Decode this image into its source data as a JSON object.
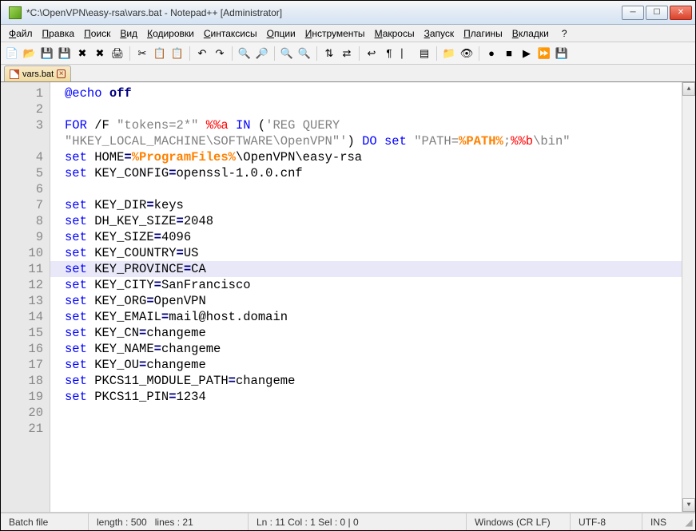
{
  "window": {
    "title": "*C:\\OpenVPN\\easy-rsa\\vars.bat - Notepad++ [Administrator]"
  },
  "menu": {
    "items": [
      "Файл",
      "Правка",
      "Поиск",
      "Вид",
      "Кодировки",
      "Синтаксисы",
      "Опции",
      "Инструменты",
      "Макросы",
      "Запуск",
      "Плагины",
      "Вкладки",
      "?"
    ]
  },
  "tab": {
    "label": "vars.bat"
  },
  "code": {
    "lines": [
      [
        {
          "t": "@echo",
          "c": "kw-blue"
        },
        {
          "t": " off",
          "c": "kw-dark"
        }
      ],
      [],
      [
        {
          "t": "FOR",
          "c": "kw-blue"
        },
        {
          "t": " /F ",
          "c": ""
        },
        {
          "t": "\"tokens=2*\"",
          "c": "str-gray"
        },
        {
          "t": " ",
          "c": ""
        },
        {
          "t": "%%a",
          "c": "kw-red"
        },
        {
          "t": " ",
          "c": ""
        },
        {
          "t": "IN",
          "c": "kw-blue"
        },
        {
          "t": " (",
          "c": ""
        },
        {
          "t": "'REG QUERY \n\"HKEY_LOCAL_MACHINE\\SOFTWARE\\OpenVPN\"'",
          "c": "str-gray"
        },
        {
          "t": ") ",
          "c": ""
        },
        {
          "t": "DO",
          "c": "kw-blue"
        },
        {
          "t": " ",
          "c": ""
        },
        {
          "t": "set",
          "c": "kw-blue"
        },
        {
          "t": " ",
          "c": ""
        },
        {
          "t": "\"PATH=",
          "c": "str-gray"
        },
        {
          "t": "%PATH%",
          "c": "var-orange"
        },
        {
          "t": ";",
          "c": "str-gray"
        },
        {
          "t": "%%b",
          "c": "kw-red"
        },
        {
          "t": "\\bin\"",
          "c": "str-gray"
        }
      ],
      [],
      [
        {
          "t": "set",
          "c": "kw-blue"
        },
        {
          "t": " HOME",
          "c": ""
        },
        {
          "t": "=",
          "c": "kw-dark"
        },
        {
          "t": "%ProgramFiles%",
          "c": "var-orange"
        },
        {
          "t": "\\OpenVPN\\easy-rsa",
          "c": ""
        }
      ],
      [
        {
          "t": "set",
          "c": "kw-blue"
        },
        {
          "t": " KEY_CONFIG",
          "c": ""
        },
        {
          "t": "=",
          "c": "kw-dark"
        },
        {
          "t": "openssl-1.0.0.cnf",
          "c": ""
        }
      ],
      [],
      [
        {
          "t": "set",
          "c": "kw-blue"
        },
        {
          "t": " KEY_DIR",
          "c": ""
        },
        {
          "t": "=",
          "c": "kw-dark"
        },
        {
          "t": "keys",
          "c": ""
        }
      ],
      [
        {
          "t": "set",
          "c": "kw-blue"
        },
        {
          "t": " DH_KEY_SIZE",
          "c": ""
        },
        {
          "t": "=",
          "c": "kw-dark"
        },
        {
          "t": "2048",
          "c": ""
        }
      ],
      [
        {
          "t": "set",
          "c": "kw-blue"
        },
        {
          "t": " KEY_SIZE",
          "c": ""
        },
        {
          "t": "=",
          "c": "kw-dark"
        },
        {
          "t": "4096",
          "c": ""
        }
      ],
      [
        {
          "t": "set",
          "c": "kw-blue"
        },
        {
          "t": " KEY_COUNTRY",
          "c": ""
        },
        {
          "t": "=",
          "c": "kw-dark"
        },
        {
          "t": "US",
          "c": ""
        }
      ],
      [
        {
          "t": "set",
          "c": "kw-blue"
        },
        {
          "t": " KEY_PROVINCE",
          "c": ""
        },
        {
          "t": "=",
          "c": "kw-dark"
        },
        {
          "t": "CA",
          "c": ""
        }
      ],
      [
        {
          "t": "set",
          "c": "kw-blue"
        },
        {
          "t": " KEY_CITY",
          "c": ""
        },
        {
          "t": "=",
          "c": "kw-dark"
        },
        {
          "t": "SanFrancisco",
          "c": ""
        }
      ],
      [
        {
          "t": "set",
          "c": "kw-blue"
        },
        {
          "t": " KEY_ORG",
          "c": ""
        },
        {
          "t": "=",
          "c": "kw-dark"
        },
        {
          "t": "OpenVPN",
          "c": ""
        }
      ],
      [
        {
          "t": "set",
          "c": "kw-blue"
        },
        {
          "t": " KEY_EMAIL",
          "c": ""
        },
        {
          "t": "=",
          "c": "kw-dark"
        },
        {
          "t": "mail@host.domain",
          "c": ""
        }
      ],
      [
        {
          "t": "set",
          "c": "kw-blue"
        },
        {
          "t": " KEY_CN",
          "c": ""
        },
        {
          "t": "=",
          "c": "kw-dark"
        },
        {
          "t": "changeme",
          "c": ""
        }
      ],
      [
        {
          "t": "set",
          "c": "kw-blue"
        },
        {
          "t": " KEY_NAME",
          "c": ""
        },
        {
          "t": "=",
          "c": "kw-dark"
        },
        {
          "t": "changeme",
          "c": ""
        }
      ],
      [
        {
          "t": "set",
          "c": "kw-blue"
        },
        {
          "t": " KEY_OU",
          "c": ""
        },
        {
          "t": "=",
          "c": "kw-dark"
        },
        {
          "t": "changeme",
          "c": ""
        }
      ],
      [
        {
          "t": "set",
          "c": "kw-blue"
        },
        {
          "t": " PKCS11_MODULE_PATH",
          "c": ""
        },
        {
          "t": "=",
          "c": "kw-dark"
        },
        {
          "t": "changeme",
          "c": ""
        }
      ],
      [
        {
          "t": "set",
          "c": "kw-blue"
        },
        {
          "t": " PKCS11_PIN",
          "c": ""
        },
        {
          "t": "=",
          "c": "kw-dark"
        },
        {
          "t": "1234",
          "c": ""
        }
      ],
      []
    ],
    "highlight_line": 11,
    "total_lines": 21
  },
  "status": {
    "filetype": "Batch file",
    "length": "length : 500",
    "lines": "lines : 21",
    "pos": "Ln : 11   Col : 1   Sel : 0 | 0",
    "eol": "Windows (CR LF)",
    "encoding": "UTF-8",
    "mode": "INS"
  },
  "toolbar_icons": [
    "new-file-icon",
    "open-file-icon",
    "save-icon",
    "save-all-icon",
    "close-icon",
    "close-all-icon",
    "print-icon",
    "sep",
    "cut-icon",
    "copy-icon",
    "paste-icon",
    "sep",
    "undo-icon",
    "redo-icon",
    "sep",
    "find-icon",
    "replace-icon",
    "sep",
    "zoom-in-icon",
    "zoom-out-icon",
    "sep",
    "sync-v-icon",
    "sync-h-icon",
    "sep",
    "wordwrap-icon",
    "show-all-icon",
    "indent-guide-icon",
    "doc-map-icon",
    "sep",
    "folder-icon",
    "monitor-icon",
    "sep",
    "record-macro-icon",
    "stop-macro-icon",
    "play-macro-icon",
    "play-multi-icon",
    "save-macro-icon"
  ]
}
